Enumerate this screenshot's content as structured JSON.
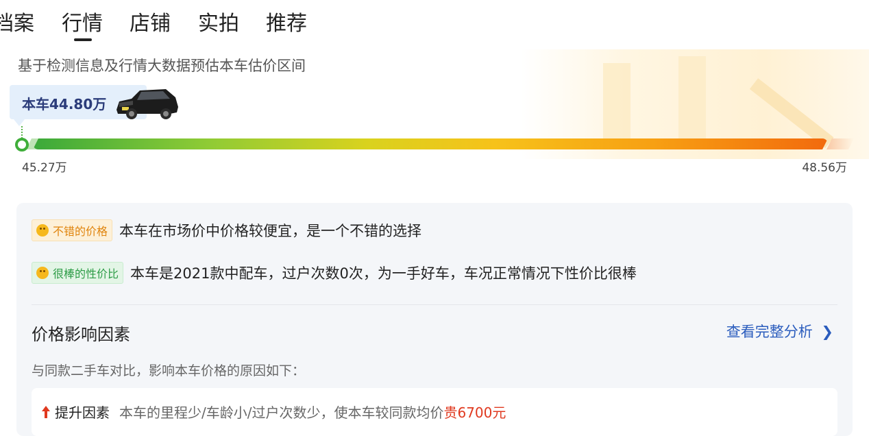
{
  "tabs": [
    "档案",
    "行情",
    "店铺",
    "实拍",
    "推荐"
  ],
  "active_tab": "行情",
  "estimate": {
    "description": "基于检测信息及行情大数据预估本车估价区间",
    "car_price": "本车44.80万",
    "low": "45.27万",
    "high": "48.56万",
    "colors": {
      "bar_start": "#3ba93a",
      "bar_mid": "#f6c21a",
      "bar_end": "#f26a0d"
    }
  },
  "tags": [
    {
      "label": "不错的价格",
      "text": "本车在市场价中价格较便宜，是一个不错的选择",
      "color": "#e0840d",
      "icon": "smile-icon"
    },
    {
      "label": "很棒的性价比",
      "text": "本车是2021款中配车，过户次数0次，为一手好车，车况正常情况下性价比很棒",
      "color": "#2c9c46",
      "icon": "grin-icon"
    }
  ],
  "factors_section": {
    "title": "价格影响因素",
    "link": "查看完整分析",
    "link_icon": "chevron-right-icon",
    "subtitle": "与同款二手车对比，影响本车价格的原因如下：",
    "factor": {
      "label": "提升因素",
      "text": "本车的里程少/车龄小/过户次数少，使本车较同款均价",
      "price": "贵6700元",
      "icon": "arrow-up-icon"
    }
  }
}
